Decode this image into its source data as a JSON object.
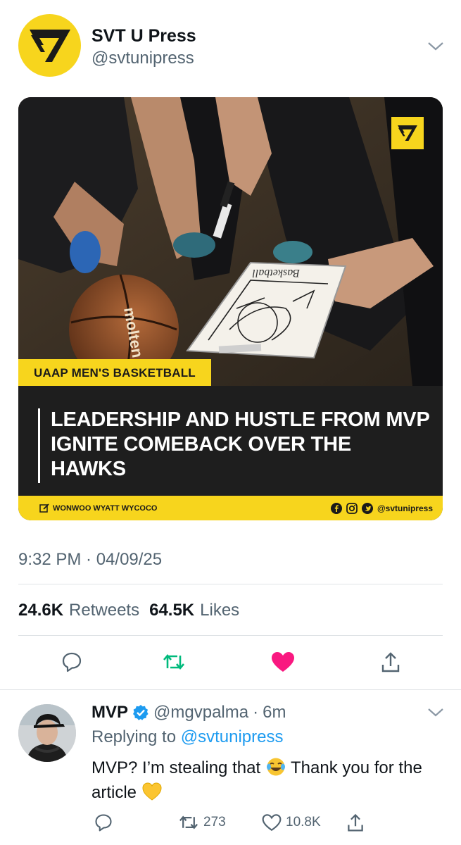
{
  "tweet": {
    "author_name": "SVT U Press",
    "author_handle": "@svtunipress",
    "timestamp": "9:32 PM · 04/09/25",
    "retweets_count": "24.6K",
    "retweets_label": "Retweets",
    "likes_count": "64.5K",
    "likes_label": "Likes"
  },
  "card": {
    "tag": "UAAP MEN'S BASKETBALL",
    "headline": "LEADERSHIP AND HUSTLE FROM MVP IGNITE COMEBACK OVER THE HAWKS",
    "author": "WONWOO WYATT WYCOCO",
    "social_handle": "@svtunipress",
    "ball_brand": "molten",
    "board_text": "Basketball"
  },
  "reply": {
    "name": "MVP",
    "handle": "@mgvpalma",
    "time": "6m",
    "replying_prefix": "Replying to",
    "replying_to": "@svtunipress",
    "text_part1": "MVP? I’m stealing that",
    "text_part2": "Thank you for the article",
    "replies_icon": "comment-icon",
    "retweets": "273",
    "likes": "10.8K"
  },
  "colors": {
    "brand_yellow": "#f7d51d",
    "like_red": "#f91880",
    "retweet_green": "#00ba7c",
    "link_blue": "#1d9bf0"
  }
}
